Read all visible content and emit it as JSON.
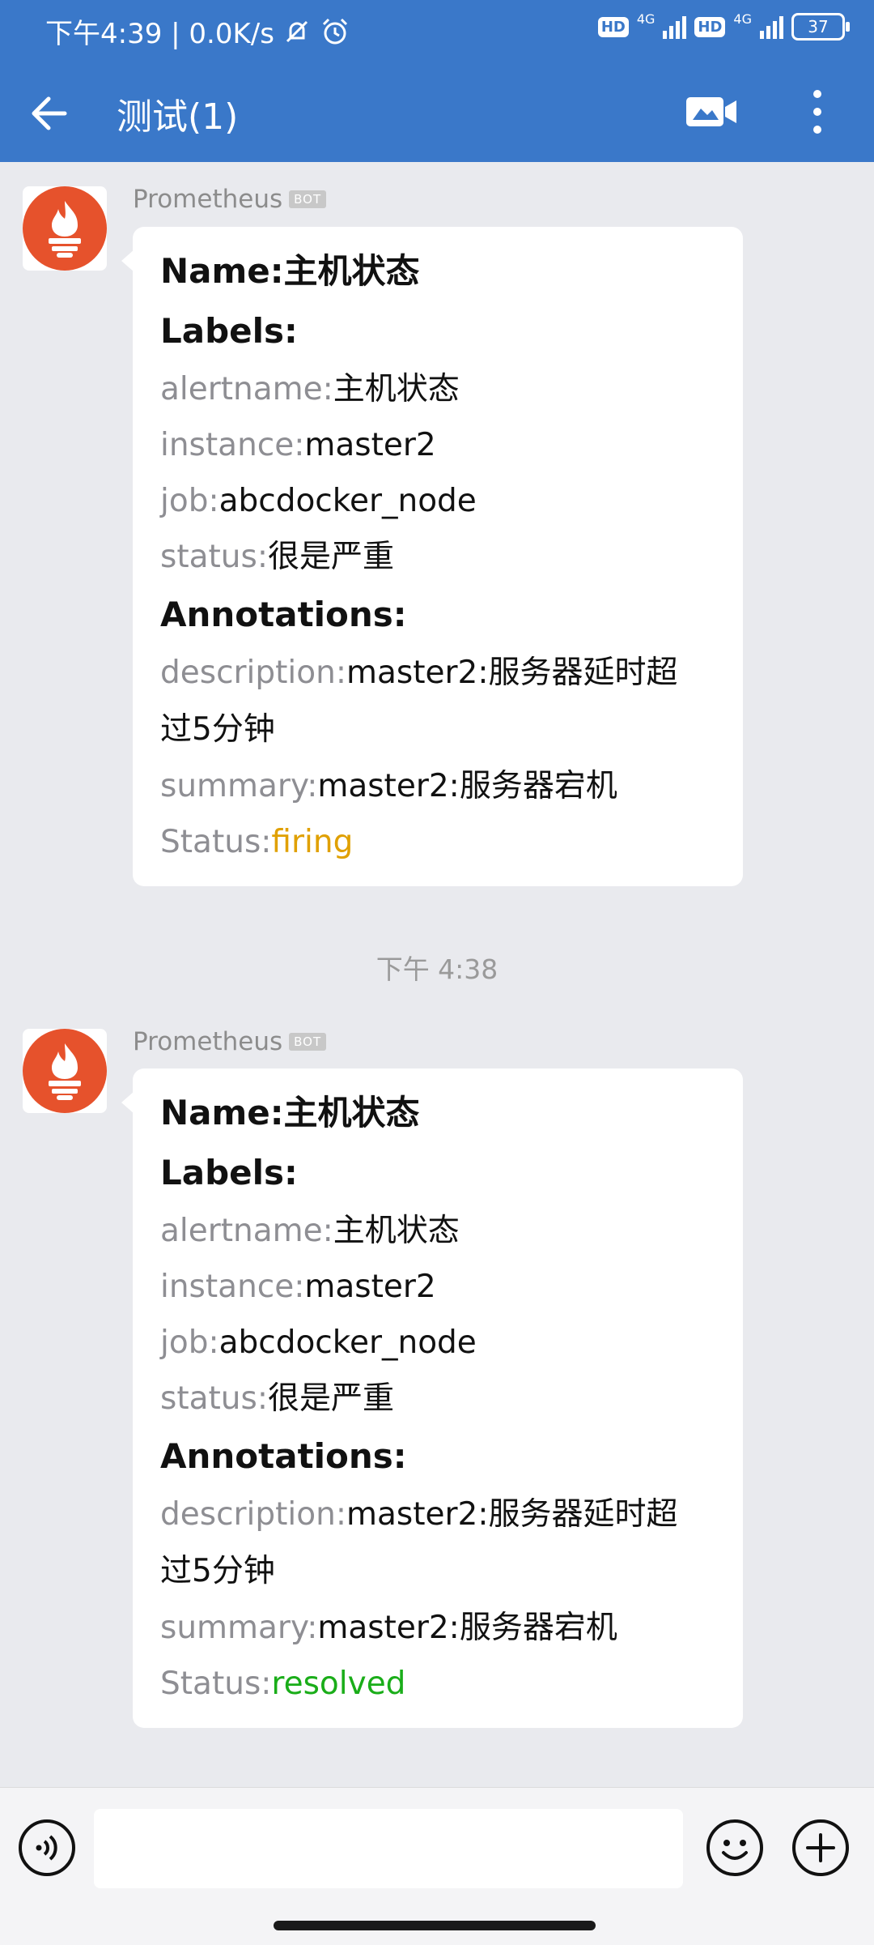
{
  "status_bar": {
    "time_net": "下午4:39 | 0.0K/s",
    "hd1": "HD",
    "net1": "4G",
    "hd2": "HD",
    "net2": "4G",
    "battery": "37"
  },
  "app_bar": {
    "title": "测试(1)"
  },
  "messages": [
    {
      "sender": "Prometheus",
      "badge": "BOT",
      "name_key": "Name:",
      "name_value": "主机状态",
      "labels_header": "Labels:",
      "alertname_key": "alertname:",
      "alertname_value": "主机状态",
      "instance_key": "instance:",
      "instance_value": "master2",
      "job_key": "job:",
      "job_value": "abcdocker_node",
      "status_key": "status:",
      "status_value": "很是严重",
      "annotations_header": "Annotations:",
      "description_key": "description:",
      "description_value_1": "master2:服务器延时超",
      "description_value_2": "过5分钟",
      "summary_key": "summary:",
      "summary_value": "master2:服务器宕机",
      "state_key": "Status:",
      "state_value": "firing"
    },
    {
      "sender": "Prometheus",
      "badge": "BOT",
      "name_key": "Name:",
      "name_value": "主机状态",
      "labels_header": "Labels:",
      "alertname_key": "alertname:",
      "alertname_value": "主机状态",
      "instance_key": "instance:",
      "instance_value": "master2",
      "job_key": "job:",
      "job_value": "abcdocker_node",
      "status_key": "status:",
      "status_value": "很是严重",
      "annotations_header": "Annotations:",
      "description_key": "description:",
      "description_value_1": "master2:服务器延时超",
      "description_value_2": "过5分钟",
      "summary_key": "summary:",
      "summary_value": "master2:服务器宕机",
      "state_key": "Status:",
      "state_value": "resolved"
    }
  ],
  "timestamp": "下午 4:38",
  "colors": {
    "brand": "#3a78c9",
    "firing": "#e0a000",
    "resolved": "#1aad19",
    "prometheus_logo": "#e6522c"
  },
  "icons": {
    "back": "arrow-left-icon",
    "video": "video-call-icon",
    "more": "more-vertical-icon",
    "voice": "voice-icon",
    "emoji": "emoji-icon",
    "add": "plus-circle-icon",
    "avatar": "prometheus-logo-icon"
  }
}
